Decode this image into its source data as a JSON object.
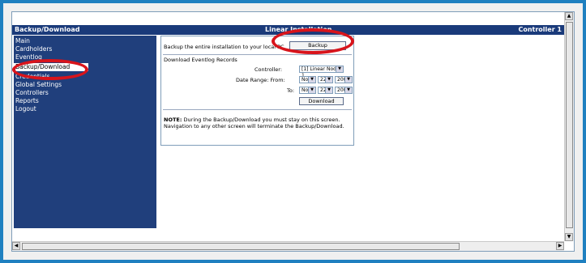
{
  "header": {
    "left_title": "Backup/Download",
    "center_title": "Linear Installation",
    "right_title": "Controller 1"
  },
  "sidebar": {
    "items": [
      {
        "label": "Main"
      },
      {
        "label": "Cardholders"
      },
      {
        "label": "Eventlog"
      },
      {
        "label": "Backup/Download",
        "active": true
      },
      {
        "label": "Credentials"
      },
      {
        "label": "Global Settings"
      },
      {
        "label": "Controllers"
      },
      {
        "label": "Reports"
      },
      {
        "label": "Logout"
      }
    ]
  },
  "backup": {
    "description": "Backup the entire installation to your local PC",
    "button_label": "Backup"
  },
  "eventlog": {
    "section_title": "Download Eventlog Records",
    "controller_label": "Controller:",
    "controller_value": "[1] Linear Node 1",
    "date_from_label": "Date Range: From:",
    "date_to_label": "To:",
    "from": {
      "month": "Nov",
      "day": "22",
      "year": "2006"
    },
    "to": {
      "month": "Nov",
      "day": "22",
      "year": "2006"
    },
    "download_label": "Download"
  },
  "note": {
    "bold": "NOTE:",
    "line1": " During the Backup/Download you must stay on this screen.",
    "line2": "Navigation to any other screen will terminate the Backup/Download."
  },
  "colors": {
    "frame": "#1f80c0",
    "nav_bg": "#203f7c",
    "highlight": "#d8141b"
  }
}
